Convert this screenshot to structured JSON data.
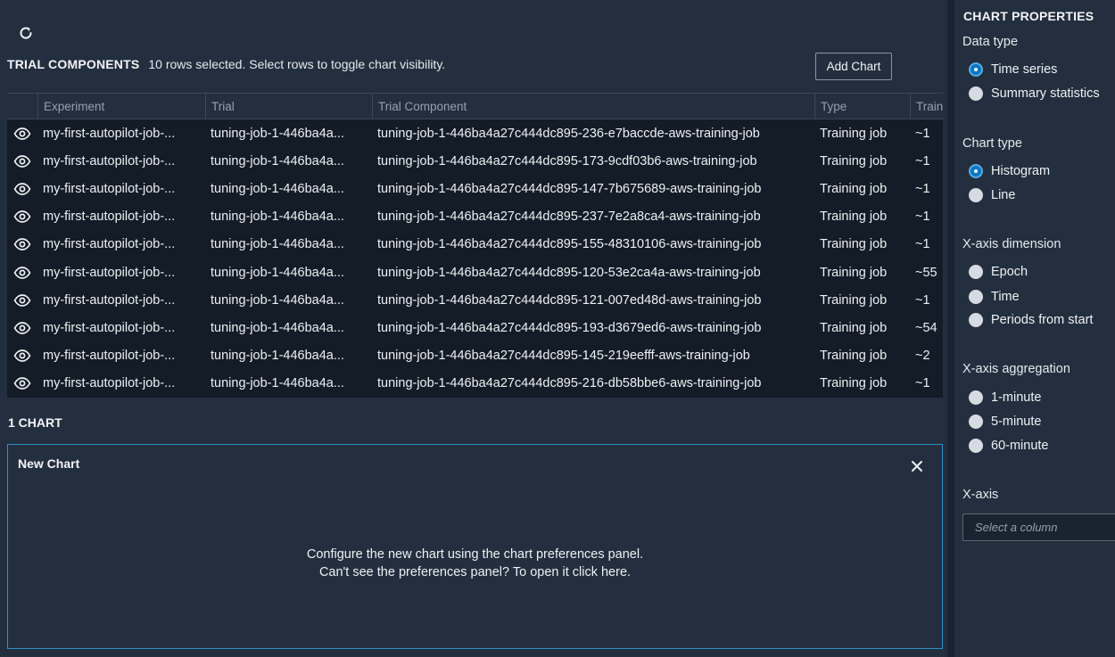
{
  "trial_components": {
    "title": "TRIAL COMPONENTS",
    "subtitle": "10 rows selected. Select rows to toggle chart visibility.",
    "add_chart_label": "Add Chart",
    "columns": [
      "Experiment",
      "Trial",
      "Trial Component",
      "Type",
      "Train"
    ],
    "rows": [
      {
        "experiment": "my-first-autopilot-job-...",
        "trial": "tuning-job-1-446ba4a...",
        "component": "tuning-job-1-446ba4a27c444dc895-236-e7baccde-aws-training-job",
        "type": "Training job",
        "train": "~1"
      },
      {
        "experiment": "my-first-autopilot-job-...",
        "trial": "tuning-job-1-446ba4a...",
        "component": "tuning-job-1-446ba4a27c444dc895-173-9cdf03b6-aws-training-job",
        "type": "Training job",
        "train": "~1"
      },
      {
        "experiment": "my-first-autopilot-job-...",
        "trial": "tuning-job-1-446ba4a...",
        "component": "tuning-job-1-446ba4a27c444dc895-147-7b675689-aws-training-job",
        "type": "Training job",
        "train": "~1"
      },
      {
        "experiment": "my-first-autopilot-job-...",
        "trial": "tuning-job-1-446ba4a...",
        "component": "tuning-job-1-446ba4a27c444dc895-237-7e2a8ca4-aws-training-job",
        "type": "Training job",
        "train": "~1"
      },
      {
        "experiment": "my-first-autopilot-job-...",
        "trial": "tuning-job-1-446ba4a...",
        "component": "tuning-job-1-446ba4a27c444dc895-155-48310106-aws-training-job",
        "type": "Training job",
        "train": "~1"
      },
      {
        "experiment": "my-first-autopilot-job-...",
        "trial": "tuning-job-1-446ba4a...",
        "component": "tuning-job-1-446ba4a27c444dc895-120-53e2ca4a-aws-training-job",
        "type": "Training job",
        "train": "~55"
      },
      {
        "experiment": "my-first-autopilot-job-...",
        "trial": "tuning-job-1-446ba4a...",
        "component": "tuning-job-1-446ba4a27c444dc895-121-007ed48d-aws-training-job",
        "type": "Training job",
        "train": "~1"
      },
      {
        "experiment": "my-first-autopilot-job-...",
        "trial": "tuning-job-1-446ba4a...",
        "component": "tuning-job-1-446ba4a27c444dc895-193-d3679ed6-aws-training-job",
        "type": "Training job",
        "train": "~54"
      },
      {
        "experiment": "my-first-autopilot-job-...",
        "trial": "tuning-job-1-446ba4a...",
        "component": "tuning-job-1-446ba4a27c444dc895-145-219eefff-aws-training-job",
        "type": "Training job",
        "train": "~2"
      },
      {
        "experiment": "my-first-autopilot-job-...",
        "trial": "tuning-job-1-446ba4a...",
        "component": "tuning-job-1-446ba4a27c444dc895-216-db58bbe6-aws-training-job",
        "type": "Training job",
        "train": "~1"
      }
    ]
  },
  "charts": {
    "count_label": "1 CHART",
    "panel": {
      "title": "New Chart",
      "message_line1": "Configure the new chart using the chart preferences panel.",
      "message_line2": "Can't see the preferences panel? To open it click here."
    }
  },
  "properties": {
    "title": "CHART PROPERTIES",
    "data_type": {
      "label": "Data type",
      "options": [
        "Time series",
        "Summary statistics"
      ],
      "selected": "Time series"
    },
    "chart_type": {
      "label": "Chart type",
      "options": [
        "Histogram",
        "Line"
      ],
      "selected": "Histogram"
    },
    "x_axis_dimension": {
      "label": "X-axis dimension",
      "options": [
        "Epoch",
        "Time",
        "Periods from start"
      ],
      "selected": ""
    },
    "x_axis_aggregation": {
      "label": "X-axis aggregation",
      "options": [
        "1-minute",
        "5-minute",
        "60-minute"
      ],
      "selected": ""
    },
    "x_axis": {
      "label": "X-axis",
      "placeholder": "Select a column"
    }
  },
  "icons": [
    "refresh-icon",
    "eye-icon",
    "close-icon"
  ],
  "colors": {
    "background": "#232f3e",
    "table_body": "#141c27",
    "accent": "#0a77c4",
    "panel_border": "#2d8fc7"
  }
}
